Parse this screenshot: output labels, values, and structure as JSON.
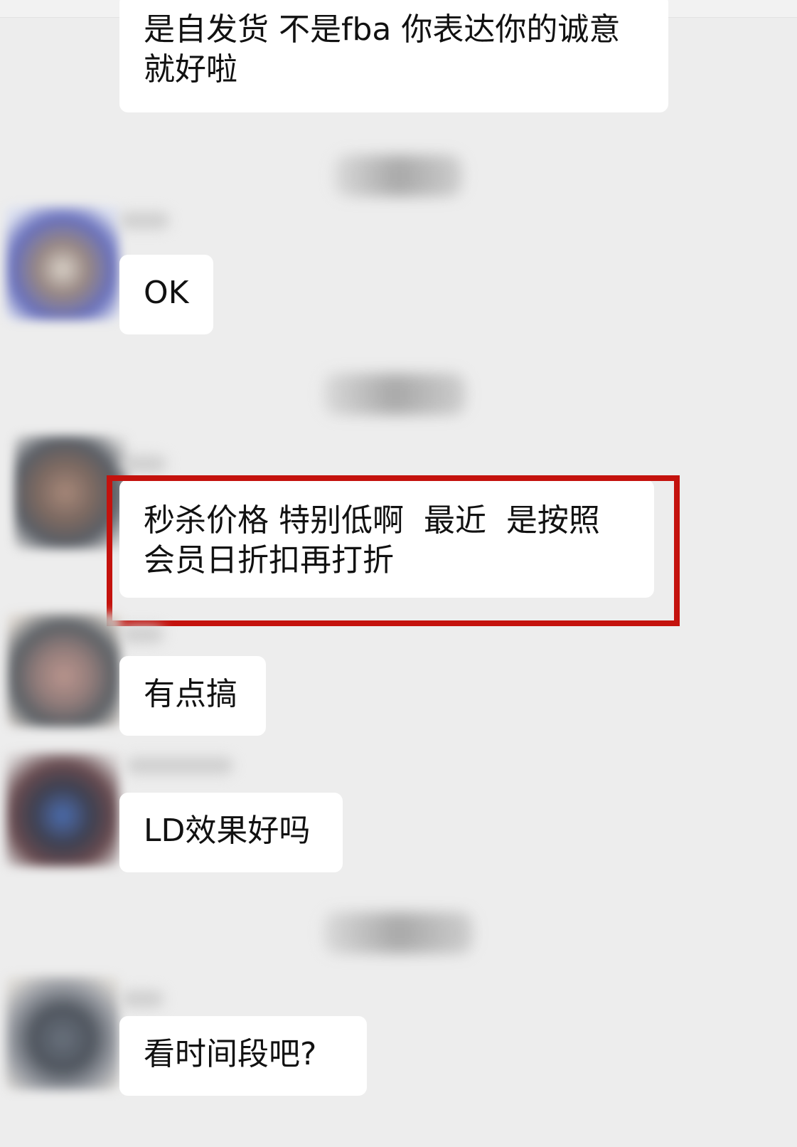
{
  "colors": {
    "background": "#ededed",
    "bubble": "#ffffff",
    "highlight_border": "#c4120d"
  },
  "messages": [
    {
      "sender": "self",
      "text": "是自发货 不是fba 你表达你的诚意\n就好啦"
    },
    {
      "sender": "other",
      "text": "OK"
    },
    {
      "sender": "other",
      "text": "秒杀价格 特别低啊  最近  是按照\n会员日折扣再打折",
      "highlighted": true
    },
    {
      "sender": "other",
      "text": "有点搞"
    },
    {
      "sender": "other",
      "text": "LD效果好吗"
    },
    {
      "sender": "other",
      "text": "看时间段吧?"
    }
  ]
}
